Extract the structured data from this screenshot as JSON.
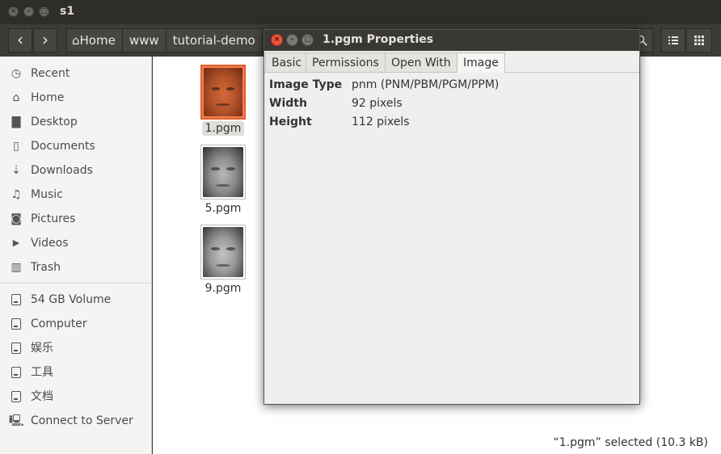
{
  "window": {
    "title": "s1"
  },
  "toolbar": {
    "back_glyph": "‹",
    "forward_glyph": "›",
    "breadcrumbs": [
      "Home",
      "www",
      "tutorial-demo"
    ],
    "search_icon": "search-icon",
    "list_view_icon": "list-view-icon",
    "grid_view_icon": "grid-view-icon"
  },
  "sidebar": {
    "items": [
      {
        "label": "Recent",
        "icon": "clock-icon",
        "glyph": "◷"
      },
      {
        "label": "Home",
        "icon": "home-icon",
        "glyph": "⌂"
      },
      {
        "label": "Desktop",
        "icon": "folder-icon",
        "glyph": "▇"
      },
      {
        "label": "Documents",
        "icon": "document-icon",
        "glyph": "▯"
      },
      {
        "label": "Downloads",
        "icon": "download-icon",
        "glyph": "⇣"
      },
      {
        "label": "Music",
        "icon": "music-icon",
        "glyph": "♫"
      },
      {
        "label": "Pictures",
        "icon": "camera-icon",
        "glyph": "◙"
      },
      {
        "label": "Videos",
        "icon": "video-icon",
        "glyph": "▶"
      },
      {
        "label": "Trash",
        "icon": "trash-icon",
        "glyph": "▥"
      }
    ],
    "devices": [
      {
        "label": "54 GB Volume",
        "icon": "drive-icon"
      },
      {
        "label": "Computer",
        "icon": "drive-icon"
      },
      {
        "label": "娱乐",
        "icon": "drive-icon"
      },
      {
        "label": "工具",
        "icon": "drive-icon"
      },
      {
        "label": "文档",
        "icon": "drive-icon"
      },
      {
        "label": "Connect to Server",
        "icon": "server-icon"
      }
    ]
  },
  "files": [
    {
      "name": "1.pgm",
      "selected": true
    },
    {
      "name": "5.pgm",
      "selected": false
    },
    {
      "name": "9.pgm",
      "selected": false
    }
  ],
  "status": {
    "text": "“1.pgm” selected  (10.3 kB)"
  },
  "dialog": {
    "title": "1.pgm Properties",
    "tabs": [
      "Basic",
      "Permissions",
      "Open With",
      "Image"
    ],
    "active_tab": "Image",
    "properties": [
      {
        "key": "Image Type",
        "value": "pnm (PNM/PBM/PGM/PPM)"
      },
      {
        "key": "Width",
        "value": "92 pixels"
      },
      {
        "key": "Height",
        "value": "112 pixels"
      }
    ]
  },
  "colors": {
    "accent_orange": "#e25f2f",
    "titlebar": "#2e2d29",
    "close_button": "#e9543a"
  }
}
